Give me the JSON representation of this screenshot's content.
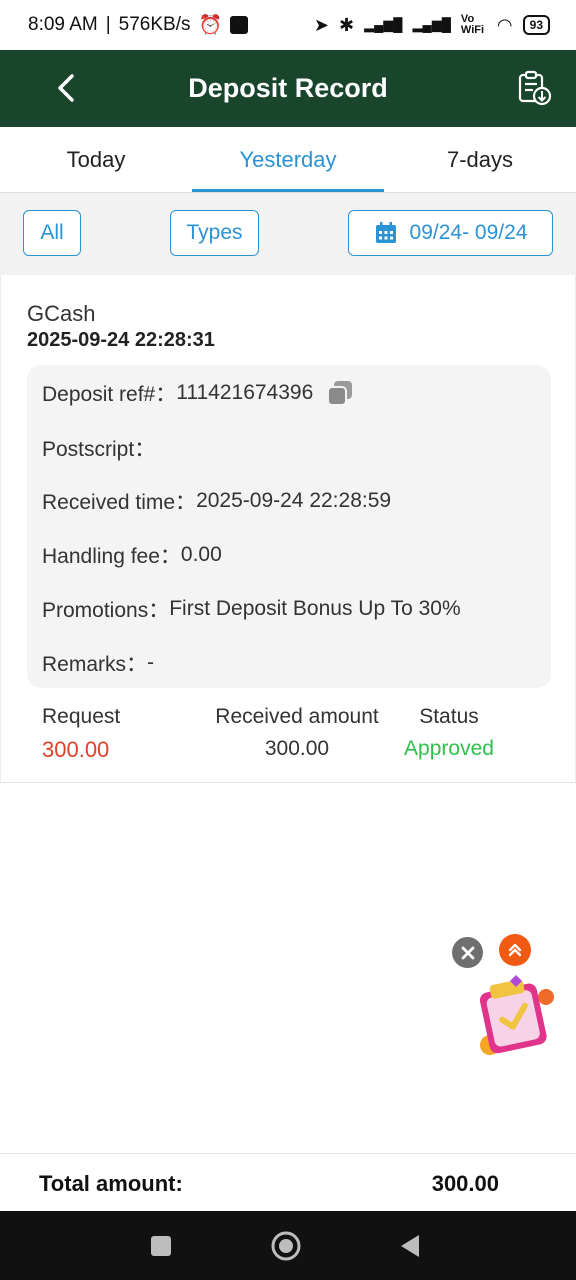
{
  "status_bar": {
    "time": "8:09 AM",
    "network_speed": "576KB/s",
    "vowifi": "Vo WiFi",
    "battery": "93"
  },
  "header": {
    "title": "Deposit Record",
    "back_icon": "chevron-left-icon",
    "export_icon": "clipboard-download-icon"
  },
  "tabs": [
    {
      "label": "Today",
      "active": false
    },
    {
      "label": "Yesterday",
      "active": true
    },
    {
      "label": "7-days",
      "active": false
    }
  ],
  "filters": {
    "all_label": "All",
    "types_label": "Types",
    "date_range": "09/24- 09/24",
    "date_icon": "calendar-icon"
  },
  "record": {
    "method": "GCash",
    "time": "2025-09-24 22:28:31",
    "details": {
      "deposit_ref_label": "Deposit ref#：",
      "deposit_ref_value": "111421674396",
      "postscript_label": "Postscript：",
      "postscript_value": "",
      "received_time_label": "Received time：",
      "received_time_value": "2025-09-24 22:28:59",
      "handling_fee_label": "Handling fee：",
      "handling_fee_value": "0.00",
      "promotions_label": "Promotions：",
      "promotions_value": "First Deposit Bonus Up To 30%",
      "remarks_label": "Remarks：",
      "remarks_value": "-"
    },
    "summary": {
      "request_label": "Request",
      "request_value": "300.00",
      "received_label": "Received amount",
      "received_value": "300.00",
      "status_label": "Status",
      "status_value": "Approved"
    }
  },
  "total": {
    "label": "Total amount:",
    "value": "300.00"
  },
  "colors": {
    "header_bg": "#18452b",
    "accent": "#2a93d5",
    "request_red": "#e0412a",
    "approved_green": "#2fbf4a"
  }
}
